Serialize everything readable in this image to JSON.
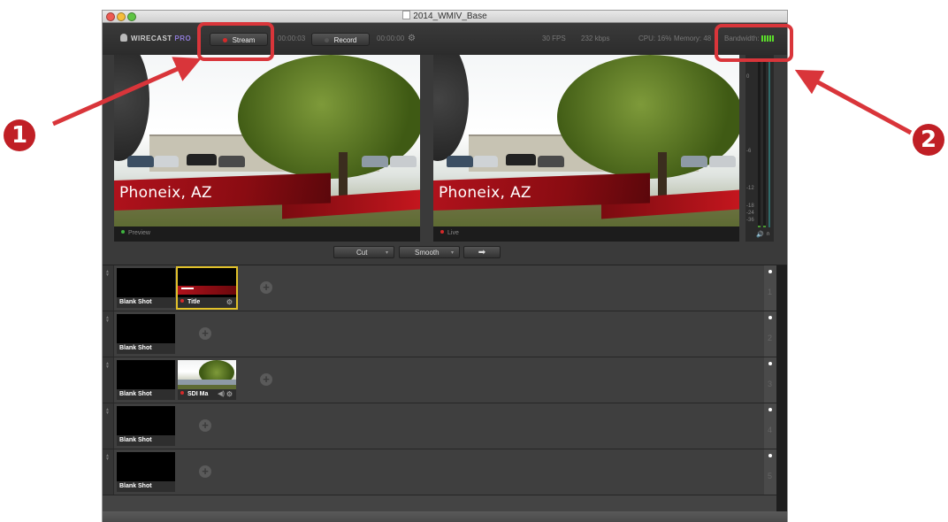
{
  "window": {
    "title": "2014_WMIV_Base"
  },
  "toolbar": {
    "logo_main": "WIRECAST",
    "logo_pro": "PRO",
    "stream_label": "Stream",
    "stream_time": "00:00:03",
    "record_label": "Record",
    "record_time": "00:00:00",
    "fps": "30 FPS",
    "kbps": "232 kbps",
    "cpu": "CPU: 16%",
    "memory": "Memory: 48",
    "bandwidth_label": "Bandwidth:"
  },
  "preview": {
    "label": "Preview",
    "banner_text": "Phoneix, AZ"
  },
  "live": {
    "label": "Live",
    "banner_text": "Phoneix, AZ"
  },
  "meter_scale": [
    "0",
    "-6",
    "-12",
    "-18",
    "-24",
    "-36"
  ],
  "transitions": {
    "cut_label": "Cut",
    "smooth_label": "Smooth",
    "go_label": "➡"
  },
  "layers": [
    {
      "number": "1",
      "shots": [
        {
          "label": "Blank Shot"
        },
        {
          "label": "Title"
        }
      ]
    },
    {
      "number": "2",
      "shots": [
        {
          "label": "Blank Shot"
        }
      ]
    },
    {
      "number": "3",
      "shots": [
        {
          "label": "Blank Shot"
        },
        {
          "label": "SDI Ma"
        }
      ]
    },
    {
      "number": "4",
      "shots": [
        {
          "label": "Blank Shot"
        }
      ]
    },
    {
      "number": "5",
      "shots": [
        {
          "label": "Blank Shot"
        }
      ]
    }
  ],
  "annotations": {
    "marker_1": "1",
    "marker_2": "2"
  },
  "colors": {
    "annotation_red": "#d9353a",
    "live_red": "#d42a2a",
    "preview_green": "#3fb43f",
    "selected_yellow": "#e0c02a",
    "bandwidth_green": "#5bdc2b"
  }
}
